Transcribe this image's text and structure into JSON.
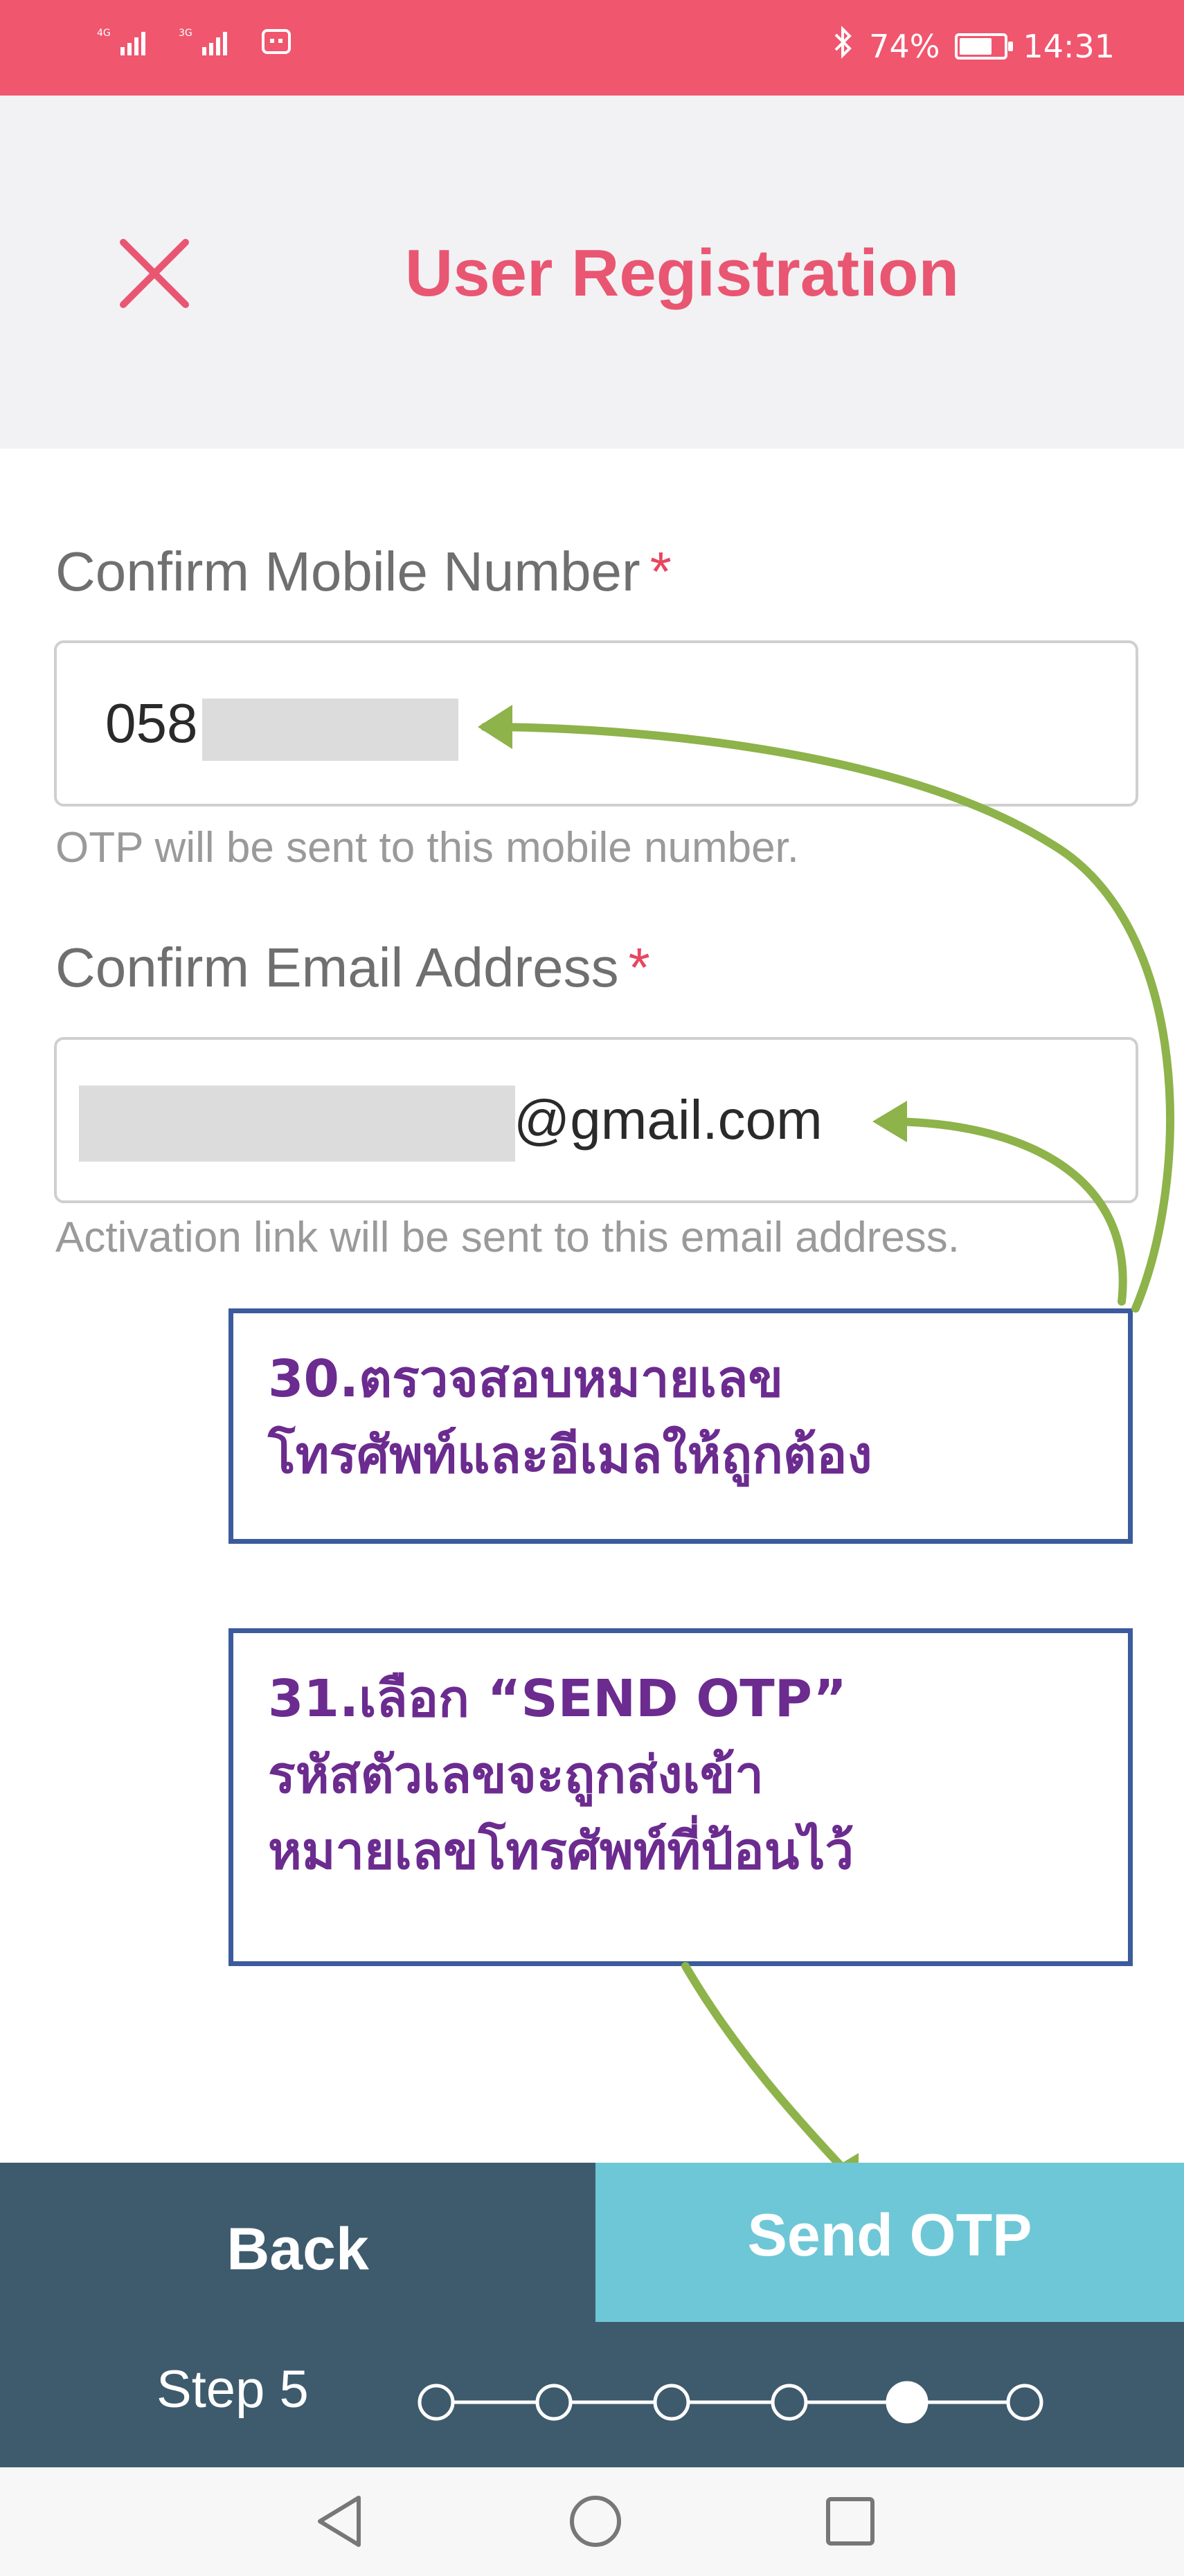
{
  "status_bar": {
    "network_1": "4G",
    "network_2": "3G",
    "battery_percent": "74%",
    "battery_level": 0.74,
    "time": "14:31"
  },
  "header": {
    "title": "User Registration",
    "close_icon": "close-icon"
  },
  "form": {
    "mobile": {
      "label": "Confirm Mobile Number",
      "required_mark": "*",
      "value_visible": "058",
      "hint": "OTP will be sent to this mobile number."
    },
    "email": {
      "label": "Confirm Email Address",
      "required_mark": "*",
      "value_visible": "@gmail.com",
      "hint": "Activation link will be sent to this email address."
    }
  },
  "annotations": {
    "note_30": "30.ตรวจสอบหมายเลข\nโทรศัพท์และอีเมลให้ถูกต้อง",
    "note_31": "31.เลือก “SEND OTP”\nรหัสตัวเลขจะถูกส่งเข้า\nหมายเลขโทรศัพท์ที่ป้อนไว้",
    "arrow_color": "#8db34a",
    "box_border_color": "#3b5b9c",
    "text_color": "#6b2b8f"
  },
  "bottom": {
    "back_label": "Back",
    "send_label": "Send OTP",
    "step_label": "Step 5",
    "steps_total": 6,
    "current_step": 5
  },
  "colors": {
    "accent": "#f0566e",
    "title": "#e95672",
    "bottom_bar": "#3e5b6d",
    "send_button": "#6ec7d6"
  },
  "nav": {
    "back_icon": "triangle-back-icon",
    "home_icon": "circle-home-icon",
    "recents_icon": "square-recents-icon"
  }
}
